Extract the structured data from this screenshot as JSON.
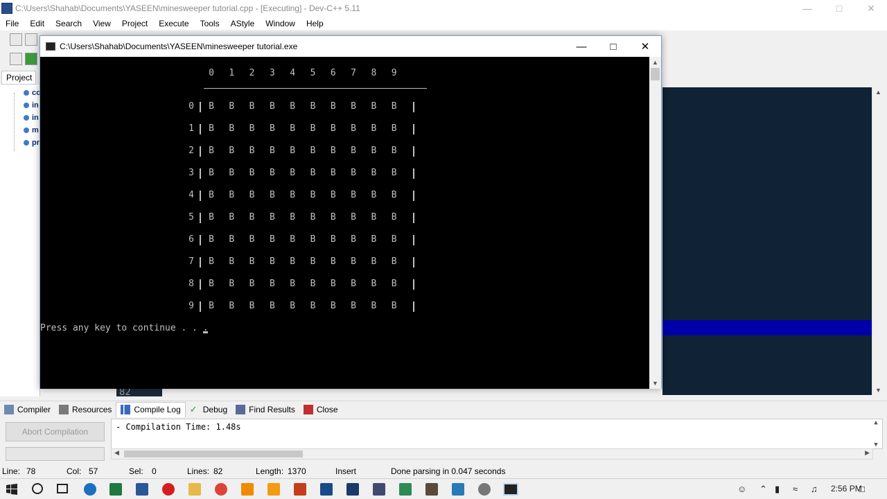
{
  "ide": {
    "title": "C:\\Users\\Shahab\\Documents\\YASEEN\\minesweeper tutorial.cpp - [Executing] - Dev-C++ 5.11",
    "menu": [
      "File",
      "Edit",
      "Search",
      "View",
      "Project",
      "Execute",
      "Tools",
      "AStyle",
      "Window",
      "Help"
    ],
    "project_tab": "Project",
    "tree_items": [
      "co",
      "in",
      "in",
      "m",
      "pr"
    ],
    "gutter_line": "82"
  },
  "console": {
    "title": "C:\\Users\\Shahab\\Documents\\YASEEN\\minesweeper tutorial.exe",
    "col_headers": [
      "0",
      "1",
      "2",
      "3",
      "4",
      "5",
      "6",
      "7",
      "8",
      "9"
    ],
    "row_labels": [
      "0",
      "1",
      "2",
      "3",
      "4",
      "5",
      "6",
      "7",
      "8",
      "9"
    ],
    "cell_value": "B",
    "press_text": "Press any key to continue . . ."
  },
  "bottom": {
    "tabs": [
      "Compiler",
      "Resources",
      "Compile Log",
      "Debug",
      "Find Results",
      "Close"
    ],
    "active_tab": "Compile Log",
    "abort_label": "Abort Compilation",
    "log_text": "- Compilation Time: 1.48s"
  },
  "status": {
    "line_label": "Line:",
    "line_value": "78",
    "col_label": "Col:",
    "col_value": "57",
    "sel_label": "Sel:",
    "sel_value": "0",
    "lines_label": "Lines:",
    "lines_value": "82",
    "length_label": "Length:",
    "length_value": "1370",
    "mode": "Insert",
    "message": "Done parsing in 0.047 seconds"
  },
  "taskbar": {
    "time": "2:56 PM"
  },
  "colors": {
    "console_bg": "#000000",
    "console_text": "#c0c0c0",
    "editor_bg": "#102235",
    "selection": "#0000a8"
  }
}
